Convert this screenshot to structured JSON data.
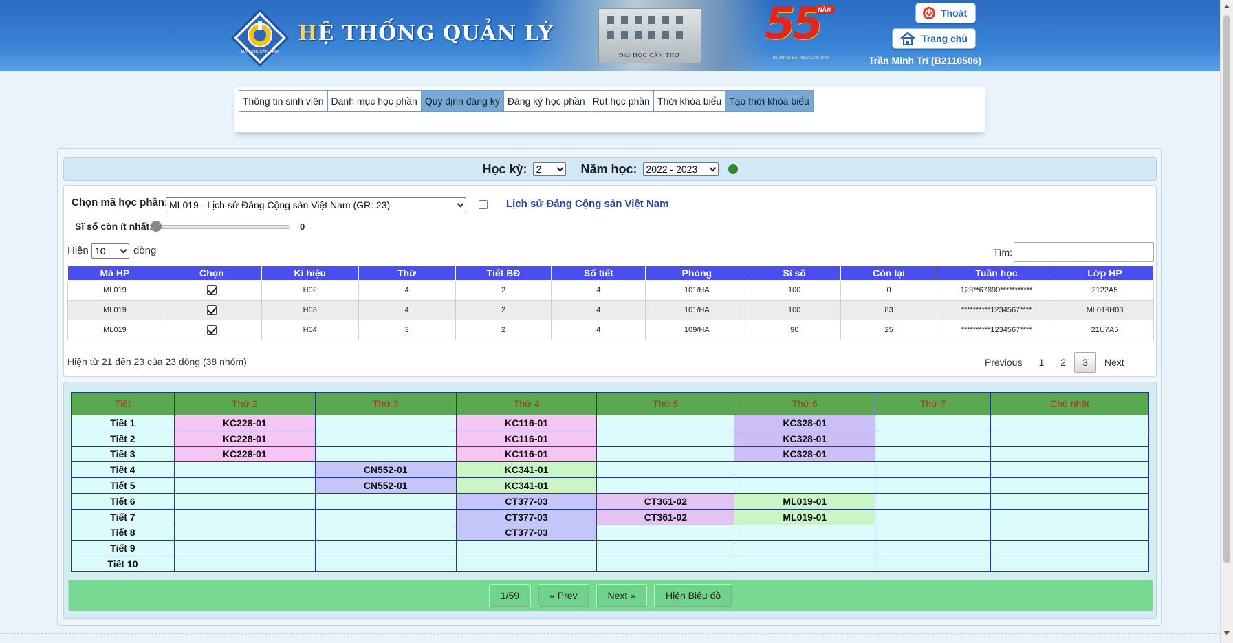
{
  "header": {
    "system_title_first": "H",
    "system_title_rest": "Ệ THỐNG QUẢN LÝ",
    "logo_text": "ĐẠI HỌC CẦN THƠ",
    "photo_caption": "ĐẠI HỌC CẦN THƠ",
    "anniversary_number": "55",
    "anniversary_word": "NĂM",
    "anniversary_sub": "TRƯỜNG ĐẠI HỌC CẦN THƠ",
    "logout_label": "Thoát",
    "home_label": "Trang chủ",
    "user_name": "Trần Minh Trí (B2110506)"
  },
  "tabs": [
    {
      "label": "Thông tin sinh viên",
      "active": false
    },
    {
      "label": "Danh mục học phần",
      "active": false
    },
    {
      "label": "Quy định đăng ký",
      "active": true
    },
    {
      "label": "Đăng ký học phần",
      "active": false
    },
    {
      "label": "Rút học phần",
      "active": false
    },
    {
      "label": "Thời khóa biểu",
      "active": false
    },
    {
      "label": "Tạo thời khóa biểu",
      "active": true
    }
  ],
  "term": {
    "semester_label": "Học kỳ:",
    "semester_value": "2",
    "year_label": "Năm học:",
    "year_value": "2022 - 2023",
    "status_color": "#2e8b2e"
  },
  "course_filter": {
    "choose_label": "Chọn mã học phần:",
    "selected_course": "ML019 - Lịch sử Đảng Cộng sản Việt Nam (GR: 23)",
    "course_name": "Lịch sử Đảng Cộng sản Việt Nam",
    "min_label": "Sĩ số còn ít nhất:",
    "min_value": "0",
    "show_label": "Hiện",
    "page_size": "10",
    "rows_label": "dòng",
    "search_label": "Tìm:",
    "search_value": ""
  },
  "course_table": {
    "headers": [
      "Mã HP",
      "Chọn",
      "Kí hiệu",
      "Thứ",
      "Tiết BĐ",
      "Số tiết",
      "Phòng",
      "Sĩ số",
      "Còn lại",
      "Tuần học",
      "Lớp HP"
    ],
    "rows": [
      [
        "ML019",
        "",
        "H02",
        "4",
        "2",
        "4",
        "101/HA",
        "100",
        "0",
        "123**67890***********",
        "2122A5"
      ],
      [
        "ML019",
        "",
        "H03",
        "4",
        "2",
        "4",
        "101/HA",
        "100",
        "83",
        "**********1234567****",
        "ML019H03"
      ],
      [
        "ML019",
        "",
        "H04",
        "3",
        "2",
        "4",
        "109/HA",
        "90",
        "25",
        "**********1234567****",
        "21U7A5"
      ]
    ],
    "info": "Hiện từ 21 đến 23 của 23 dòng (38 nhóm)",
    "pager": {
      "previous": "Previous",
      "pages": [
        "1",
        "2",
        "3"
      ],
      "current": "3",
      "next": "Next"
    }
  },
  "timetable": {
    "headers": [
      "Tiết",
      "Thứ 2",
      "Thứ 3",
      "Thứ 4",
      "Thứ 5",
      "Thứ 6",
      "Thứ 7",
      "Chủ nhật"
    ],
    "rows": [
      [
        "Tiết 1",
        "KC228-01",
        "",
        "KC116-01",
        "",
        "KC328-01",
        "",
        ""
      ],
      [
        "Tiết 2",
        "KC228-01",
        "",
        "KC116-01",
        "",
        "KC328-01",
        "",
        ""
      ],
      [
        "Tiết 3",
        "KC228-01",
        "",
        "KC116-01",
        "",
        "KC328-01",
        "",
        ""
      ],
      [
        "Tiết 4",
        "",
        "CN552-01",
        "KC341-01",
        "",
        "",
        "",
        ""
      ],
      [
        "Tiết 5",
        "",
        "CN552-01",
        "KC341-01",
        "",
        "",
        "",
        ""
      ],
      [
        "Tiết 6",
        "",
        "",
        "CT377-03",
        "CT361-02",
        "ML019-01",
        "",
        ""
      ],
      [
        "Tiết 7",
        "",
        "",
        "CT377-03",
        "CT361-02",
        "ML019-01",
        "",
        ""
      ],
      [
        "Tiết 8",
        "",
        "",
        "CT377-03",
        "",
        "",
        "",
        ""
      ],
      [
        "Tiết 9",
        "",
        "",
        "",
        "",
        "",
        "",
        ""
      ],
      [
        "Tiết 10",
        "",
        "",
        "",
        "",
        "",
        "",
        ""
      ]
    ],
    "course_colors": {
      "KC228-01": "c-pink",
      "KC116-01": "c-pink",
      "KC328-01": "c-violet",
      "CN552-01": "c-blue",
      "KC341-01": "c-green",
      "CT377-03": "c-blue",
      "CT361-02": "c-magenta",
      "ML019-01": "c-green"
    }
  },
  "schedule_nav": {
    "counter": "1/59",
    "prev": "« Prev",
    "next": "Next »",
    "chart": "Hiện Biểu đồ"
  }
}
